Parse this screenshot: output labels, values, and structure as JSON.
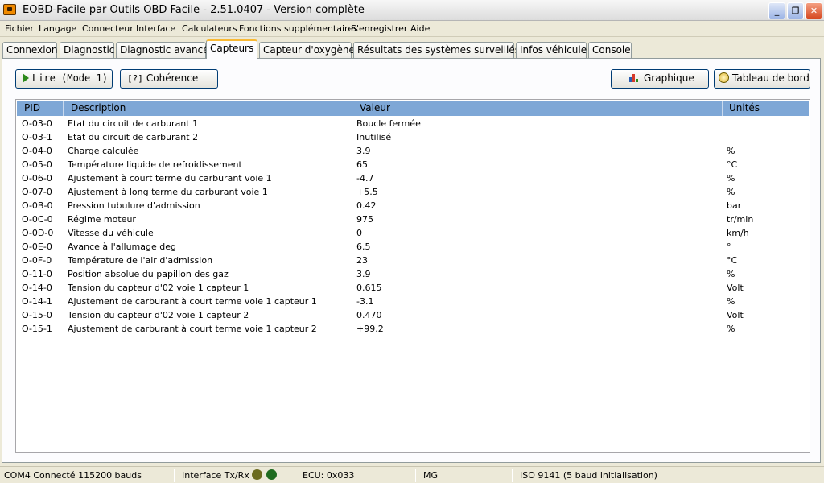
{
  "window": {
    "title": "EOBD-Facile par Outils OBD Facile - 2.51.0407 - Version complète",
    "controls": {
      "minimize": "_",
      "maximize": "❐",
      "close": "✕"
    }
  },
  "menu": [
    "Fichier",
    "Langage",
    "Connecteur",
    "Interface",
    "Calculateurs",
    "Fonctions supplémentaires",
    "S'enregistrer",
    "Aide"
  ],
  "tabs": [
    "Connexion",
    "Diagnostic",
    "Diagnostic avancé",
    "Capteurs",
    "Capteur d'oxygène",
    "Résultats des systèmes surveillés",
    "Infos véhicule",
    "Console"
  ],
  "active_tab": "Capteurs",
  "toolbar": {
    "read_label": "Lire (Mode 1)",
    "coherence_icon": "[?]",
    "coherence_label": "Cohérence",
    "graph_label": "Graphique",
    "dashboard_label": "Tableau de bord"
  },
  "table": {
    "headers": {
      "pid": "PID",
      "description": "Description",
      "value": "Valeur",
      "units": "Unités"
    },
    "rows": [
      {
        "pid": "O-03-0",
        "description": "Etat du circuit de carburant 1",
        "value": "Boucle fermée",
        "units": ""
      },
      {
        "pid": "O-03-1",
        "description": "Etat du circuit de carburant 2",
        "value": "Inutilisé",
        "units": ""
      },
      {
        "pid": "O-04-0",
        "description": "Charge calculée",
        "value": "3.9",
        "units": "%"
      },
      {
        "pid": "O-05-0",
        "description": "Température liquide de refroidissement",
        "value": "65",
        "units": "°C"
      },
      {
        "pid": "O-06-0",
        "description": "Ajustement à court terme du carburant voie 1",
        "value": "-4.7",
        "units": "%"
      },
      {
        "pid": "O-07-0",
        "description": "Ajustement à long terme du carburant voie 1",
        "value": "+5.5",
        "units": "%"
      },
      {
        "pid": "O-0B-0",
        "description": "Pression tubulure d'admission",
        "value": "0.42",
        "units": "bar"
      },
      {
        "pid": "O-0C-0",
        "description": "Régime moteur",
        "value": "975",
        "units": "tr/min"
      },
      {
        "pid": "O-0D-0",
        "description": "Vitesse du véhicule",
        "value": "0",
        "units": "km/h"
      },
      {
        "pid": "O-0E-0",
        "description": "Avance à l'allumage deg",
        "value": "6.5",
        "units": "°"
      },
      {
        "pid": "O-0F-0",
        "description": "Température de l'air d'admission",
        "value": "23",
        "units": "°C"
      },
      {
        "pid": "O-11-0",
        "description": "Position absolue du papillon des gaz",
        "value": "3.9",
        "units": "%"
      },
      {
        "pid": "O-14-0",
        "description": "Tension du capteur d'02 voie 1 capteur 1",
        "value": "0.615",
        "units": "Volt"
      },
      {
        "pid": "O-14-1",
        "description": "Ajustement de carburant à court terme voie 1 capteur 1",
        "value": "-3.1",
        "units": "%"
      },
      {
        "pid": "O-15-0",
        "description": "Tension du capteur d'02 voie 1 capteur 2",
        "value": "0.470",
        "units": "Volt"
      },
      {
        "pid": "O-15-1",
        "description": "Ajustement de carburant à court terme voie 1 capteur 2",
        "value": "+99.2",
        "units": "%"
      }
    ]
  },
  "status": {
    "connection": "COM4 Connecté 115200 bauds",
    "interface": "Interface Tx/Rx",
    "led_colors": [
      "#6b6b1e",
      "#1f6b1f"
    ],
    "ecu": "ECU: 0x033",
    "brand": "MG",
    "protocol": "ISO 9141 (5 baud initialisation)"
  },
  "colors": {
    "header_bg": "#7ea7d6",
    "active_tab_accent": "#f9b934",
    "play_green": "#2d8a1b"
  }
}
